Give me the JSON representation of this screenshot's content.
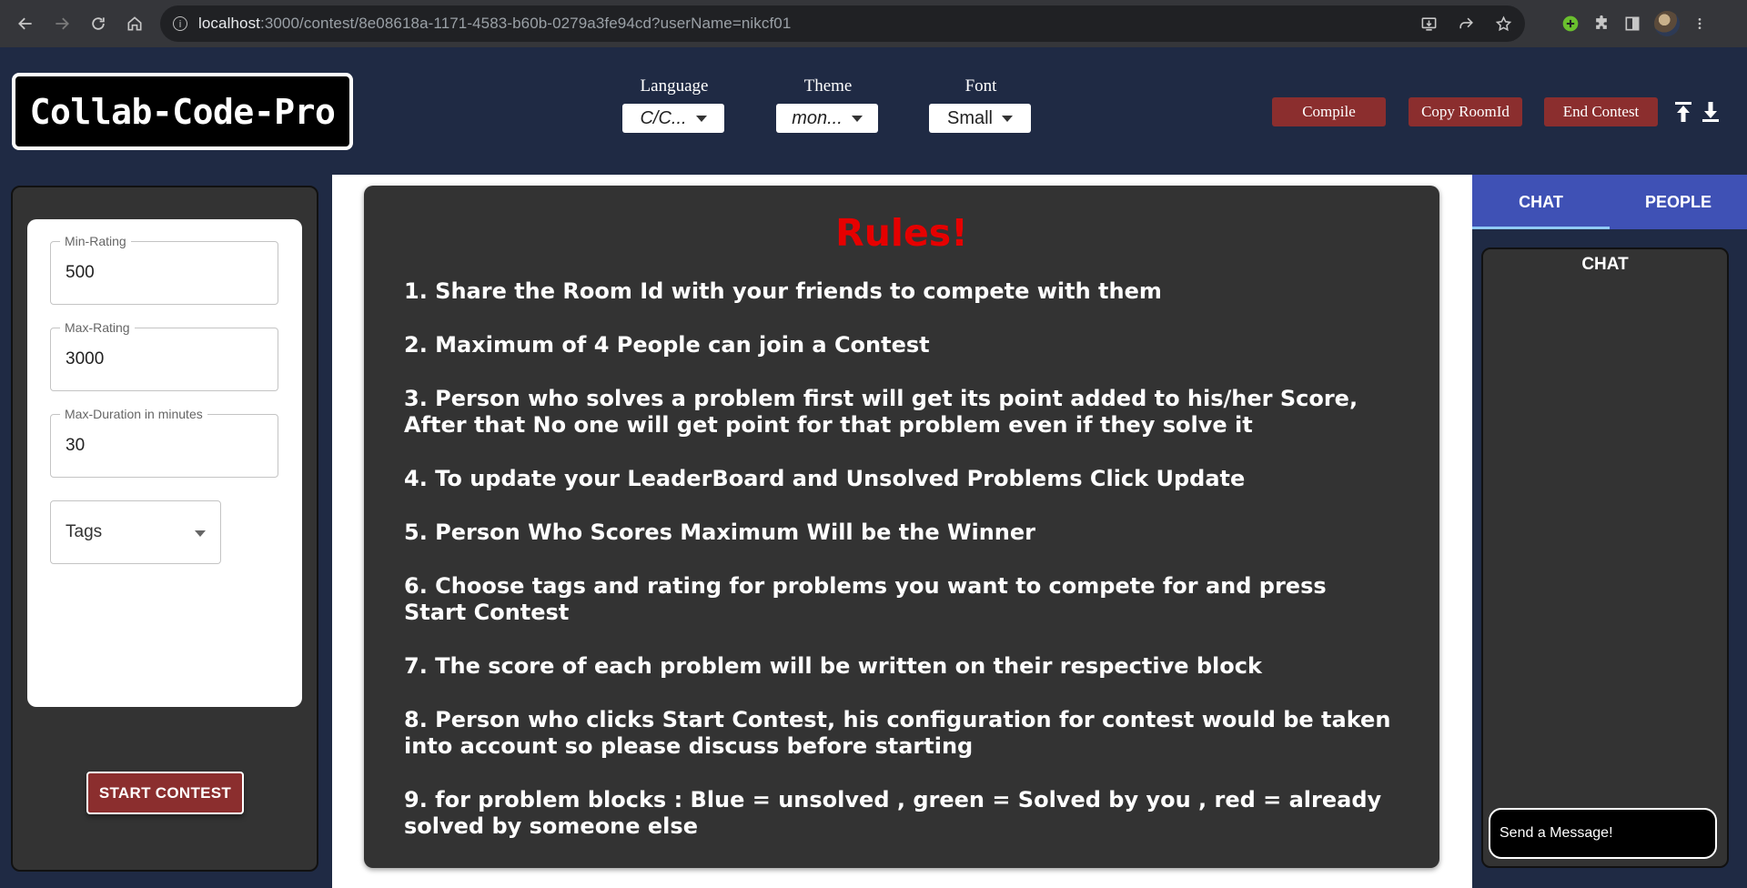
{
  "browser": {
    "url_host": "localhost",
    "url_rest": ":3000/contest/8e08618a-1171-4583-b60b-0279a3fe94cd?userName=nikcf01"
  },
  "header": {
    "logo": "Collab-Code-Pro",
    "language": {
      "label": "Language",
      "value": "C/C..."
    },
    "theme": {
      "label": "Theme",
      "value": "mon..."
    },
    "font": {
      "label": "Font",
      "value": "Small"
    },
    "compile": "Compile",
    "copy_room": "Copy RoomId",
    "end_contest": "End Contest"
  },
  "settings": {
    "min_rating_label": "Min-Rating",
    "min_rating": "500",
    "max_rating_label": "Max-Rating",
    "max_rating": "3000",
    "max_duration_label": "Max-Duration in minutes",
    "max_duration": "30",
    "tags_label": "Tags",
    "start_button": "START CONTEST"
  },
  "rules": {
    "title": "Rules!",
    "items": [
      "1. Share the Room Id with your friends to compete with them",
      "2. Maximum of 4 People can join a Contest",
      "3. Person who solves a problem first will get its point added to his/her Score, After that No one will get point for that problem even if they solve it",
      "4. To update your LeaderBoard and Unsolved Problems Click Update",
      "5. Person Who Scores Maximum Will be the Winner",
      "6. Choose tags and rating for problems you want to compete for and press Start Contest",
      "7. The score of each problem will be written on their respective block",
      "8. Person who clicks Start Contest, his configuration for contest would be taken into account so please discuss before starting",
      "9. for problem blocks : Blue = unsolved , green = Solved by you , red = already solved by someone else"
    ]
  },
  "sidebar": {
    "tabs": [
      "CHAT",
      "PEOPLE"
    ],
    "chat_title": "CHAT",
    "message_placeholder": "Send a Message!"
  },
  "colors": {
    "header_bg": "#1f2a44",
    "button_red": "#8b2e2e",
    "rules_title": "#e60000",
    "tab_blue": "#3f51b5"
  }
}
